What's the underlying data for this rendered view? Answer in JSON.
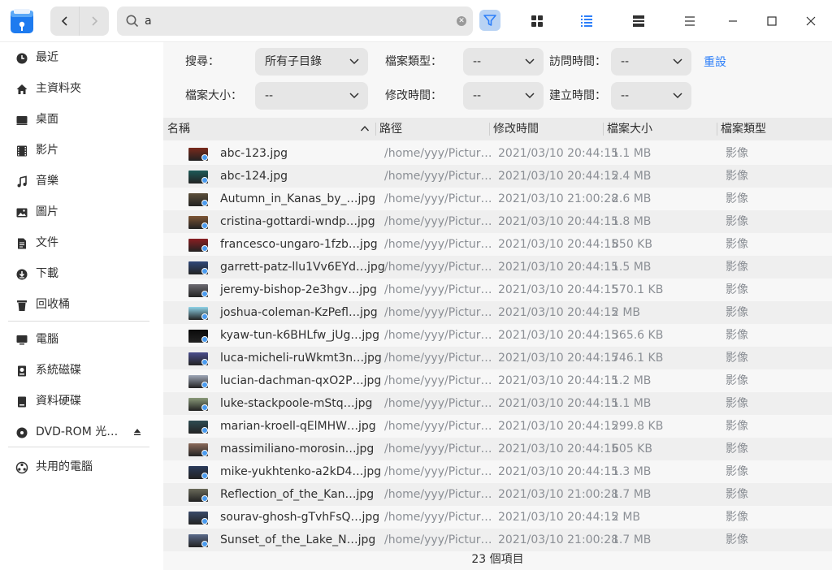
{
  "titlebar": {
    "search_value": "a",
    "toolbar_icons": [
      "filter-icon",
      "icon-view-icon",
      "list-view-icon",
      "detail-view-icon",
      "menu-icon",
      "minimize-icon",
      "maximize-icon",
      "close-icon"
    ]
  },
  "sidebar": {
    "items": [
      {
        "label": "最近",
        "icon": "clock-icon"
      },
      {
        "label": "主資料夾",
        "icon": "home-icon"
      },
      {
        "label": "桌面",
        "icon": "desktop-icon"
      },
      {
        "label": "影片",
        "icon": "video-icon"
      },
      {
        "label": "音樂",
        "icon": "music-icon"
      },
      {
        "label": "圖片",
        "icon": "picture-icon"
      },
      {
        "label": "文件",
        "icon": "document-icon"
      },
      {
        "label": "下載",
        "icon": "download-icon"
      },
      {
        "label": "回收桶",
        "icon": "trash-icon"
      },
      {
        "label": "電腦",
        "icon": "computer-icon"
      },
      {
        "label": "系統磁碟",
        "icon": "system-disk-icon"
      },
      {
        "label": "資料硬碟",
        "icon": "data-disk-icon"
      },
      {
        "label": "DVD-ROM 光…",
        "icon": "dvd-icon"
      },
      {
        "label": "共用的電腦",
        "icon": "network-icon"
      }
    ]
  },
  "filters": {
    "search_label": "搜尋：",
    "search_scope": "所有子目錄",
    "file_type_label": "檔案類型：",
    "file_type_value": "--",
    "access_time_label": "訪問時間：",
    "access_time_value": "--",
    "reset_label": "重設",
    "file_size_label": "檔案大小：",
    "file_size_value": "--",
    "modify_time_label": "修改時間：",
    "modify_time_value": "--",
    "create_time_label": "建立時間：",
    "create_time_value": "--"
  },
  "table": {
    "columns": [
      "名稱",
      "路徑",
      "修改時間",
      "檔案大小",
      "檔案類型"
    ],
    "rows": [
      {
        "name": "abc-123.jpg",
        "path": "/home/yyy/Pictur…",
        "mtime": "2021/03/10 20:44:15",
        "size": "1.1 MB",
        "type": "影像",
        "thumb": "#7a2a1c"
      },
      {
        "name": "abc-124.jpg",
        "path": "/home/yyy/Pictur…",
        "mtime": "2021/03/10 20:44:15",
        "size": "2.4 MB",
        "type": "影像",
        "thumb": "#1d5a58"
      },
      {
        "name": "Autumn_in_Kanas_by_…jpg",
        "path": "/home/yyy/Pictur…",
        "mtime": "2021/03/10 21:00:28",
        "size": "2.6 MB",
        "type": "影像",
        "thumb": "#5b4e3a"
      },
      {
        "name": "cristina-gottardi-wndp…jpg",
        "path": "/home/yyy/Pictur…",
        "mtime": "2021/03/10 20:44:15",
        "size": "1.8 MB",
        "type": "影像",
        "thumb": "#7d5535"
      },
      {
        "name": "francesco-ungaro-1fzb…jpg",
        "path": "/home/yyy/Pictur…",
        "mtime": "2021/03/10 20:44:15",
        "size": "850 KB",
        "type": "影像",
        "thumb": "#8a1e22"
      },
      {
        "name": "garrett-patz-llu1Vv6EYd…jpg",
        "path": "/home/yyy/Pictur…",
        "mtime": "2021/03/10 20:44:15",
        "size": "1.5 MB",
        "type": "影像",
        "thumb": "#2f4778"
      },
      {
        "name": "jeremy-bishop-2e3hgv…jpg",
        "path": "/home/yyy/Pictur…",
        "mtime": "2021/03/10 20:44:15",
        "size": "570.1 KB",
        "type": "影像",
        "thumb": "#6c6a72"
      },
      {
        "name": "joshua-coleman-KzPefl…jpg",
        "path": "/home/yyy/Pictur…",
        "mtime": "2021/03/10 20:44:15",
        "size": "2 MB",
        "type": "影像",
        "thumb": "#8fd3e8"
      },
      {
        "name": "kyaw-tun-k6BHLfw_jUg…jpg",
        "path": "/home/yyy/Pictur…",
        "mtime": "2021/03/10 20:44:15",
        "size": "365.6 KB",
        "type": "影像",
        "thumb": "#0a0a0a"
      },
      {
        "name": "luca-micheli-ruWkmt3n…jpg",
        "path": "/home/yyy/Pictur…",
        "mtime": "2021/03/10 20:44:15",
        "size": "746.1 KB",
        "type": "影像",
        "thumb": "#4a4d8c"
      },
      {
        "name": "lucian-dachman-qxO2P…jpg",
        "path": "/home/yyy/Pictur…",
        "mtime": "2021/03/10 20:44:15",
        "size": "1.2 MB",
        "type": "影像",
        "thumb": "#a0a8b8"
      },
      {
        "name": "luke-stackpoole-mStq…jpg",
        "path": "/home/yyy/Pictur…",
        "mtime": "2021/03/10 20:44:15",
        "size": "1.1 MB",
        "type": "影像",
        "thumb": "#8a9a7a"
      },
      {
        "name": "marian-kroell-qElMHW…jpg",
        "path": "/home/yyy/Pictur…",
        "mtime": "2021/03/10 20:44:15",
        "size": "299.8 KB",
        "type": "影像",
        "thumb": "#2e4c52"
      },
      {
        "name": "massimiliano-morosin…jpg",
        "path": "/home/yyy/Pictur…",
        "mtime": "2021/03/10 20:44:15",
        "size": "605 KB",
        "type": "影像",
        "thumb": "#8a6a5a"
      },
      {
        "name": "mike-yukhtenko-a2kD4…jpg",
        "path": "/home/yyy/Pictur…",
        "mtime": "2021/03/10 20:44:15",
        "size": "1.3 MB",
        "type": "影像",
        "thumb": "#2a3a5a"
      },
      {
        "name": "Reflection_of_the_Kan…jpg",
        "path": "/home/yyy/Pictur…",
        "mtime": "2021/03/10 21:00:28",
        "size": "1.7 MB",
        "type": "影像",
        "thumb": "#6a6a5a"
      },
      {
        "name": "sourav-ghosh-gTvhFsQ…jpg",
        "path": "/home/yyy/Pictur…",
        "mtime": "2021/03/10 20:44:15",
        "size": "2 MB",
        "type": "影像",
        "thumb": "#3a4a6a"
      },
      {
        "name": "Sunset_of_the_Lake_N…jpg",
        "path": "/home/yyy/Pictur…",
        "mtime": "2021/03/10 21:00:28",
        "size": "1.7 MB",
        "type": "影像",
        "thumb": "#5a6a8a"
      }
    ]
  },
  "status": {
    "item_count": "23 個項目"
  },
  "colors": {
    "accent": "#2d7ff9",
    "filter_active": "#b9d3f4"
  }
}
